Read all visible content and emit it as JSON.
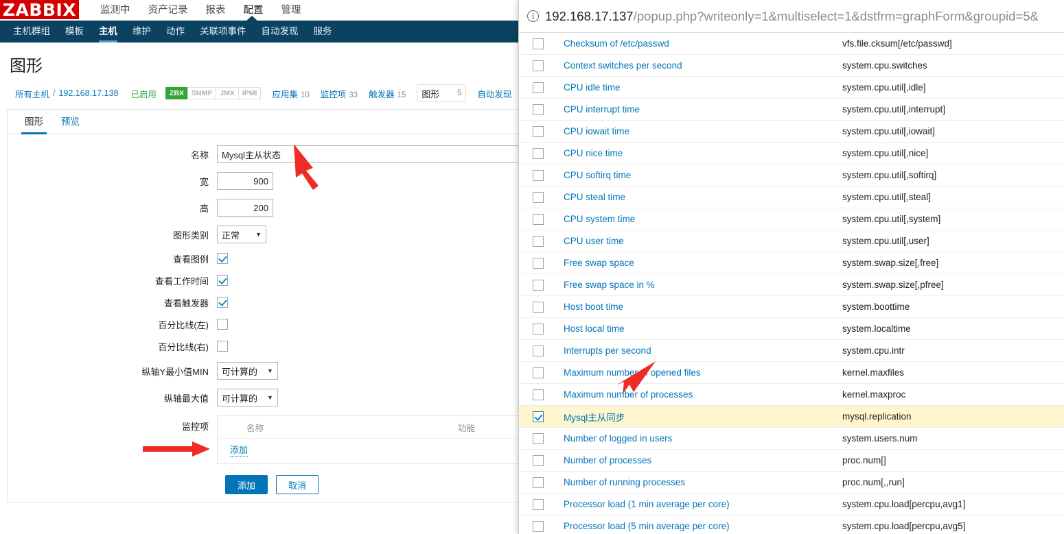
{
  "app": {
    "logo": "ZABBIX",
    "top_menu": [
      {
        "label": "监测中",
        "active": false
      },
      {
        "label": "资产记录",
        "active": false
      },
      {
        "label": "报表",
        "active": false
      },
      {
        "label": "配置",
        "active": true
      },
      {
        "label": "管理",
        "active": false
      }
    ],
    "sub_nav": [
      {
        "label": "主机群组",
        "active": false
      },
      {
        "label": "模板",
        "active": false
      },
      {
        "label": "主机",
        "active": true
      },
      {
        "label": "维护",
        "active": false
      },
      {
        "label": "动作",
        "active": false
      },
      {
        "label": "关联项事件",
        "active": false
      },
      {
        "label": "自动发现",
        "active": false
      },
      {
        "label": "服务",
        "active": false
      }
    ],
    "page_title": "图形",
    "breadcrumb": {
      "all_hosts": "所有主机",
      "separator": "/",
      "host": "192.168.17.138",
      "status": "已启用",
      "interfaces": [
        {
          "label": "ZBX",
          "active": true
        },
        {
          "label": "SNMP",
          "active": false
        },
        {
          "label": "JMX",
          "active": false
        },
        {
          "label": "IPMI",
          "active": false
        }
      ],
      "counts": [
        {
          "label": "应用集",
          "num": "10",
          "selected": false
        },
        {
          "label": "监控项",
          "num": "33",
          "selected": false
        },
        {
          "label": "触发器",
          "num": "15",
          "selected": false
        },
        {
          "label": "图形",
          "num": "5",
          "selected": true
        },
        {
          "label": "自动发现",
          "num": "",
          "selected": false
        }
      ]
    },
    "tabs": [
      {
        "label": "图形",
        "active": true
      },
      {
        "label": "预览",
        "active": false
      }
    ],
    "form": {
      "name_label": "名称",
      "name_value": "Mysql主从状态",
      "width_label": "宽",
      "width_value": "900",
      "height_label": "高",
      "height_value": "200",
      "graph_type_label": "图形类别",
      "graph_type_value": "正常",
      "show_legend_label": "查看图例",
      "show_legend_checked": true,
      "show_working_time_label": "查看工作时间",
      "show_working_time_checked": true,
      "show_triggers_label": "查看触发器",
      "show_triggers_checked": true,
      "percentile_left_label": "百分比线(左)",
      "percentile_left_checked": false,
      "percentile_right_label": "百分比线(右)",
      "percentile_right_checked": false,
      "ymin_label": "纵轴Y最小值MIN",
      "ymin_value": "可计算的",
      "ymax_label": "纵轴最大值",
      "ymax_value": "可计算的",
      "items_label": "监控项",
      "items_col_name": "名称",
      "items_col_function": "功能",
      "items_add_link": "添加",
      "submit_label": "添加",
      "cancel_label": "取消"
    }
  },
  "popup": {
    "url_host": "192.168.17.137",
    "url_path": "/popup.php?writeonly=1&multiselect=1&dstfrm=graphForm&groupid=5&",
    "info_glyph": "i",
    "rows": [
      {
        "name": "Checksum of /etc/passwd",
        "key": "vfs.file.cksum[/etc/passwd]",
        "checked": false
      },
      {
        "name": "Context switches per second",
        "key": "system.cpu.switches",
        "checked": false
      },
      {
        "name": "CPU idle time",
        "key": "system.cpu.util[,idle]",
        "checked": false
      },
      {
        "name": "CPU interrupt time",
        "key": "system.cpu.util[,interrupt]",
        "checked": false
      },
      {
        "name": "CPU iowait time",
        "key": "system.cpu.util[,iowait]",
        "checked": false
      },
      {
        "name": "CPU nice time",
        "key": "system.cpu.util[,nice]",
        "checked": false
      },
      {
        "name": "CPU softirq time",
        "key": "system.cpu.util[,softirq]",
        "checked": false
      },
      {
        "name": "CPU steal time",
        "key": "system.cpu.util[,steal]",
        "checked": false
      },
      {
        "name": "CPU system time",
        "key": "system.cpu.util[,system]",
        "checked": false
      },
      {
        "name": "CPU user time",
        "key": "system.cpu.util[,user]",
        "checked": false
      },
      {
        "name": "Free swap space",
        "key": "system.swap.size[,free]",
        "checked": false
      },
      {
        "name": "Free swap space in %",
        "key": "system.swap.size[,pfree]",
        "checked": false
      },
      {
        "name": "Host boot time",
        "key": "system.boottime",
        "checked": false
      },
      {
        "name": "Host local time",
        "key": "system.localtime",
        "checked": false
      },
      {
        "name": "Interrupts per second",
        "key": "system.cpu.intr",
        "checked": false
      },
      {
        "name": "Maximum number of opened files",
        "key": "kernel.maxfiles",
        "checked": false
      },
      {
        "name": "Maximum number of processes",
        "key": "kernel.maxproc",
        "checked": false
      },
      {
        "name": "Mysql主从同步",
        "key": "mysql.replication",
        "checked": true
      },
      {
        "name": "Number of logged in users",
        "key": "system.users.num",
        "checked": false
      },
      {
        "name": "Number of processes",
        "key": "proc.num[]",
        "checked": false
      },
      {
        "name": "Number of running processes",
        "key": "proc.num[,,run]",
        "checked": false
      },
      {
        "name": "Processor load (1 min average per core)",
        "key": "system.cpu.load[percpu,avg1]",
        "checked": false
      },
      {
        "name": "Processor load (5 min average per core)",
        "key": "system.cpu.load[percpu,avg5]",
        "checked": false
      }
    ]
  },
  "annotations": {
    "arrow_color": "#ee2b24",
    "arrow_name_field": "arrow-pointing-to-name-field",
    "arrow_items_add": "arrow-pointing-to-items-add-link",
    "arrow_popup_item": "arrow-pointing-to-item-row"
  }
}
